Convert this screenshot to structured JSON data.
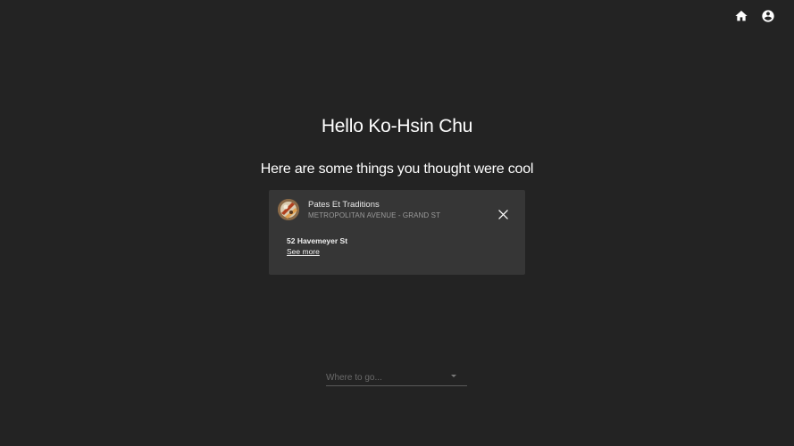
{
  "header": {
    "home_icon": "home-icon",
    "account_icon": "account-circle-icon"
  },
  "main": {
    "greeting": "Hello Ko-Hsin Chu",
    "subtitle": "Here are some things you thought were cool"
  },
  "card": {
    "title": "Pates Et Traditions",
    "subtitle": "METROPOLITAN AVENUE - GRAND ST",
    "address": "52 Havemeyer St",
    "link_label": "See more",
    "close_icon": "close-icon"
  },
  "destination_select": {
    "placeholder": "Where to go...",
    "arrow_icon": "dropdown-arrow-icon"
  },
  "colors": {
    "background": "#232323",
    "card_background": "#363636",
    "text": "#ffffff",
    "muted_text": "#9a9a9a"
  }
}
